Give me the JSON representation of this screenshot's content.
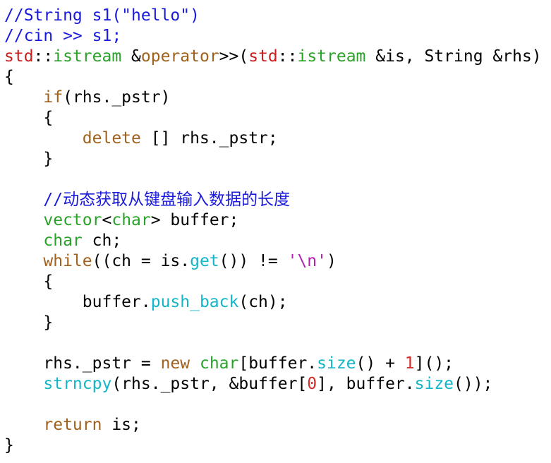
{
  "colors": {
    "plain": "#000000",
    "comment": "#1a1adb",
    "keyword": "#a0611c",
    "type": "#2aa22a",
    "ns": "#c81e1e",
    "func": "#13b5c6",
    "string_lit": "#b320b3",
    "number": "#d42b2b"
  },
  "code": {
    "lines": [
      [
        {
          "t": "//String s1(\"hello\")",
          "c": "comment"
        }
      ],
      [
        {
          "t": "//cin >> s1;",
          "c": "comment"
        }
      ],
      [
        {
          "t": "std",
          "c": "ns"
        },
        {
          "t": "::",
          "c": "plain"
        },
        {
          "t": "istream",
          "c": "type"
        },
        {
          "t": " &",
          "c": "plain"
        },
        {
          "t": "operator",
          "c": "keyword"
        },
        {
          "t": ">>(",
          "c": "plain"
        },
        {
          "t": "std",
          "c": "ns"
        },
        {
          "t": "::",
          "c": "plain"
        },
        {
          "t": "istream",
          "c": "type"
        },
        {
          "t": " &is, String &rhs)",
          "c": "plain"
        }
      ],
      [
        {
          "t": "{",
          "c": "plain"
        }
      ],
      [
        {
          "t": "    ",
          "c": "plain"
        },
        {
          "t": "if",
          "c": "keyword"
        },
        {
          "t": "(rhs._pstr)",
          "c": "plain"
        }
      ],
      [
        {
          "t": "    {",
          "c": "plain"
        }
      ],
      [
        {
          "t": "        ",
          "c": "plain"
        },
        {
          "t": "delete",
          "c": "keyword"
        },
        {
          "t": " [] rhs._pstr;",
          "c": "plain"
        }
      ],
      [
        {
          "t": "    }",
          "c": "plain"
        }
      ],
      [],
      [
        {
          "t": "    ",
          "c": "plain"
        },
        {
          "t": "//动态获取从键盘输入数据的长度",
          "c": "comment"
        }
      ],
      [
        {
          "t": "    ",
          "c": "plain"
        },
        {
          "t": "vector",
          "c": "type"
        },
        {
          "t": "<",
          "c": "plain"
        },
        {
          "t": "char",
          "c": "type"
        },
        {
          "t": "> buffer;",
          "c": "plain"
        }
      ],
      [
        {
          "t": "    ",
          "c": "plain"
        },
        {
          "t": "char",
          "c": "type"
        },
        {
          "t": " ch;",
          "c": "plain"
        }
      ],
      [
        {
          "t": "    ",
          "c": "plain"
        },
        {
          "t": "while",
          "c": "keyword"
        },
        {
          "t": "((ch = is.",
          "c": "plain"
        },
        {
          "t": "get",
          "c": "func"
        },
        {
          "t": "()) != ",
          "c": "plain"
        },
        {
          "t": "'\\n'",
          "c": "string_lit"
        },
        {
          "t": ")",
          "c": "plain"
        }
      ],
      [
        {
          "t": "    {",
          "c": "plain"
        }
      ],
      [
        {
          "t": "        buffer.",
          "c": "plain"
        },
        {
          "t": "push_back",
          "c": "func"
        },
        {
          "t": "(ch);",
          "c": "plain"
        }
      ],
      [
        {
          "t": "    }",
          "c": "plain"
        }
      ],
      [],
      [
        {
          "t": "    rhs._pstr = ",
          "c": "plain"
        },
        {
          "t": "new",
          "c": "keyword"
        },
        {
          "t": " ",
          "c": "plain"
        },
        {
          "t": "char",
          "c": "type"
        },
        {
          "t": "[buffer.",
          "c": "plain"
        },
        {
          "t": "size",
          "c": "func"
        },
        {
          "t": "() + ",
          "c": "plain"
        },
        {
          "t": "1",
          "c": "number"
        },
        {
          "t": "]();",
          "c": "plain"
        }
      ],
      [
        {
          "t": "    ",
          "c": "plain"
        },
        {
          "t": "strncpy",
          "c": "func"
        },
        {
          "t": "(rhs._pstr, &buffer[",
          "c": "plain"
        },
        {
          "t": "0",
          "c": "number"
        },
        {
          "t": "], buffer.",
          "c": "plain"
        },
        {
          "t": "size",
          "c": "func"
        },
        {
          "t": "());",
          "c": "plain"
        }
      ],
      [],
      [
        {
          "t": "    ",
          "c": "plain"
        },
        {
          "t": "return",
          "c": "keyword"
        },
        {
          "t": " is;",
          "c": "plain"
        }
      ],
      [
        {
          "t": "}",
          "c": "plain"
        }
      ]
    ]
  }
}
